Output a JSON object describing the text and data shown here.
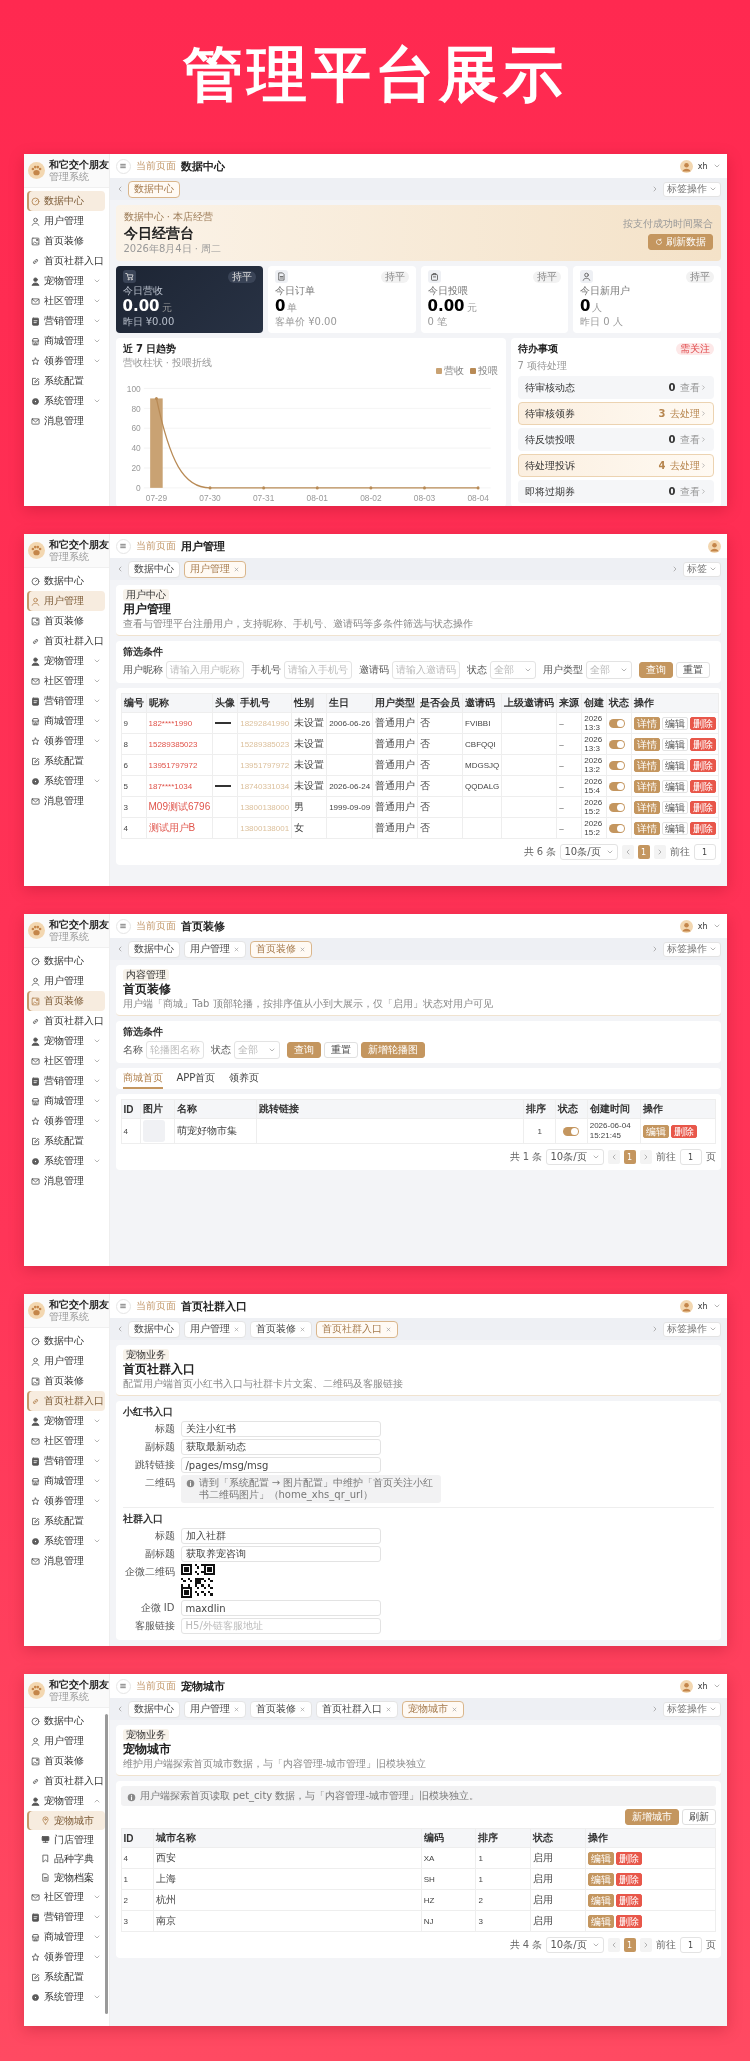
{
  "title": "管理平台展示",
  "screens": [
    {
      "sidebar": {
        "brand": "和它交个朋友",
        "subtitle": "管理系统",
        "items": [
          {
            "label": "数据中心",
            "kind": "link",
            "selected": true
          },
          {
            "label": "用户管理",
            "kind": "link",
            "selected": false
          },
          {
            "label": "首页装修",
            "kind": "link",
            "selected": false
          },
          {
            "label": "首页社群入口",
            "kind": "link",
            "selected": false
          },
          {
            "label": "宠物管理",
            "kind": "group",
            "expanded": false,
            "selected": false
          },
          {
            "label": "社区管理",
            "kind": "group",
            "expanded": false,
            "selected": false
          },
          {
            "label": "营销管理",
            "kind": "group",
            "expanded": false,
            "selected": false
          },
          {
            "label": "商城管理",
            "kind": "group",
            "expanded": false,
            "selected": false
          },
          {
            "label": "领券管理",
            "kind": "group",
            "expanded": false,
            "selected": false
          },
          {
            "label": "系统配置",
            "kind": "link",
            "selected": false
          },
          {
            "label": "系统管理",
            "kind": "group",
            "expanded": false,
            "selected": false
          },
          {
            "label": "消息管理",
            "kind": "link",
            "selected": false
          }
        ]
      },
      "header": {
        "crumb": "当前页面",
        "title": "数据中心",
        "user": "xh"
      },
      "tabs": [
        {
          "label": "数据中心",
          "selected": true,
          "closable": false
        }
      ],
      "tab_actions": "标签操作",
      "content": {
        "kind": "dashboard",
        "hero": {
          "crumb": "数据中心 · 本店经营",
          "title": "今日经营台",
          "date": "2026年8月4日 · 周二",
          "note": "按支付成功时间聚合",
          "button": "刷新数据"
        },
        "stats": [
          {
            "label": "今日营收",
            "value": "0.00",
            "unit": "元",
            "sub": "昨日 ¥0.00",
            "badge": "持平",
            "highlighted": true
          },
          {
            "label": "今日订单",
            "value": "0",
            "unit": "单",
            "sub": "客单价 ¥0.00",
            "badge": "持平",
            "highlighted": false
          },
          {
            "label": "今日投喂",
            "value": "0.00",
            "unit": "元",
            "sub": "0 笔",
            "badge": "持平",
            "highlighted": false
          },
          {
            "label": "今日新用户",
            "value": "0",
            "unit": "人",
            "sub": "昨日 0 人",
            "badge": "持平",
            "highlighted": false
          }
        ],
        "trend": {
          "title": "近 7 日趋势",
          "subtitle": "营收柱状 · 投喂折线",
          "chart_data": {
            "type": "bar",
            "categories": [
              "07-29",
              "07-30",
              "07-31",
              "08-01",
              "08-02",
              "08-03",
              "08-04"
            ],
            "series": [
              {
                "name": "营收",
                "color": "#c9a273",
                "values": [
                  90,
                  0,
                  0,
                  0,
                  0,
                  0,
                  0
                ]
              },
              {
                "name": "投喂",
                "type": "line",
                "color": "#b88a55",
                "values": [
                  90,
                  0,
                  0,
                  0,
                  0,
                  0,
                  0
                ]
              }
            ],
            "ylim": [
              0,
              100
            ],
            "yticks": [
              0,
              20,
              40,
              60,
              80,
              100
            ],
            "grid": true
          }
        },
        "todo": {
          "title": "待办事项",
          "subtitle": "7 项待处理",
          "badge": "需关注",
          "items": [
            {
              "label": "待审核动态",
              "count": "0",
              "action": "查看",
              "urgent": false
            },
            {
              "label": "待审核领券",
              "count": "3",
              "action": "去处理",
              "urgent": true
            },
            {
              "label": "待反馈投喂",
              "count": "0",
              "action": "查看",
              "urgent": false
            },
            {
              "label": "待处理投诉",
              "count": "4",
              "action": "去处理",
              "urgent": true
            },
            {
              "label": "即将过期券",
              "count": "0",
              "action": "查看",
              "urgent": false
            }
          ]
        }
      }
    },
    {
      "sidebar": {
        "brand": "和它交个朋友",
        "subtitle": "管理系统",
        "items": [
          {
            "label": "数据中心",
            "kind": "link",
            "selected": false
          },
          {
            "label": "用户管理",
            "kind": "link",
            "selected": true
          },
          {
            "label": "首页装修",
            "kind": "link",
            "selected": false
          },
          {
            "label": "首页社群入口",
            "kind": "link",
            "selected": false
          },
          {
            "label": "宠物管理",
            "kind": "group",
            "expanded": false,
            "selected": false
          },
          {
            "label": "社区管理",
            "kind": "group",
            "expanded": false,
            "selected": false
          },
          {
            "label": "营销管理",
            "kind": "group",
            "expanded": false,
            "selected": false
          },
          {
            "label": "商城管理",
            "kind": "group",
            "expanded": false,
            "selected": false
          },
          {
            "label": "领券管理",
            "kind": "group",
            "expanded": false,
            "selected": false
          },
          {
            "label": "系统配置",
            "kind": "link",
            "selected": false
          },
          {
            "label": "系统管理",
            "kind": "group",
            "expanded": false,
            "selected": false
          },
          {
            "label": "消息管理",
            "kind": "link",
            "selected": false
          }
        ]
      },
      "header": {
        "crumb": "当前页面",
        "title": "用户管理"
      },
      "tabs": [
        {
          "label": "数据中心",
          "selected": false,
          "closable": false
        },
        {
          "label": "用户管理",
          "selected": true,
          "closable": true
        }
      ],
      "tab_actions": "标签",
      "content": {
        "kind": "users",
        "head": {
          "tag": "用户中心",
          "title": "用户管理",
          "desc": "查看与管理平台注册用户，支持昵称、手机号、邀请码等多条件筛选与状态操作"
        },
        "filter": {
          "title": "筛选条件",
          "fields": [
            {
              "label": "用户昵称",
              "kind": "input",
              "placeholder": "请输入用户昵称"
            },
            {
              "label": "手机号",
              "kind": "input",
              "placeholder": "请输入手机号"
            },
            {
              "label": "邀请码",
              "kind": "input",
              "placeholder": "请输入邀请码"
            },
            {
              "label": "状态",
              "kind": "select",
              "placeholder": "全部"
            },
            {
              "label": "用户类型",
              "kind": "select",
              "placeholder": "全部"
            }
          ],
          "buttons": [
            {
              "label": "查询",
              "kind": "primary"
            },
            {
              "label": "重置",
              "kind": "plain"
            }
          ]
        },
        "table": {
          "columns": [
            "编号",
            "昵称",
            "头像",
            "手机号",
            "性别",
            "生日",
            "用户类型",
            "是否会员",
            "邀请码",
            "上级邀请码",
            "来源",
            "创建",
            "状态",
            "操作"
          ],
          "rows": [
            {
              "id": "9",
              "nickname": "182****1990",
              "avatar": true,
              "phone": "18292841990",
              "gender": "未设置",
              "birthday": "2006-06-26",
              "type": "普通用户",
              "member": "否",
              "invite": "FVIBBI",
              "source": "–",
              "created": "2026 13:3",
              "on": true,
              "actions": [
                {
                  "label": "详情",
                  "kind": "primary"
                },
                {
                  "label": "编辑",
                  "kind": "plain"
                },
                {
                  "label": "删除",
                  "kind": "danger"
                }
              ]
            },
            {
              "id": "8",
              "nickname": "15289385023",
              "avatar": false,
              "phone": "15289385023",
              "gender": "未设置",
              "type": "普通用户",
              "member": "否",
              "invite": "CBFQQI",
              "source": "–",
              "created": "2026 13:3",
              "on": true,
              "actions": [
                {
                  "label": "详情",
                  "kind": "primary"
                },
                {
                  "label": "编辑",
                  "kind": "plain"
                },
                {
                  "label": "删除",
                  "kind": "danger"
                }
              ]
            },
            {
              "id": "6",
              "nickname": "13951797972",
              "avatar": false,
              "phone": "13951797972",
              "gender": "未设置",
              "type": "普通用户",
              "member": "否",
              "invite": "MDGSJQ",
              "source": "–",
              "created": "2026 13:2",
              "on": true,
              "actions": [
                {
                  "label": "详情",
                  "kind": "primary"
                },
                {
                  "label": "编辑",
                  "kind": "plain"
                },
                {
                  "label": "删除",
                  "kind": "danger"
                }
              ]
            },
            {
              "id": "5",
              "nickname": "187****1034",
              "avatar": true,
              "phone": "18740331034",
              "gender": "未设置",
              "birthday": "2026-06-24",
              "type": "普通用户",
              "member": "否",
              "invite": "QQDALG",
              "source": "–",
              "created": "2026 15:4",
              "on": true,
              "actions": [
                {
                  "label": "详情",
                  "kind": "primary"
                },
                {
                  "label": "编辑",
                  "kind": "plain"
                },
                {
                  "label": "删除",
                  "kind": "danger"
                }
              ]
            },
            {
              "id": "3",
              "nickname": "M09测试6796",
              "avatar": false,
              "phone": "13800138000",
              "gender": "男",
              "birthday": "1999-09-09",
              "type": "普通用户",
              "member": "否",
              "source": "–",
              "created": "2026 15:2",
              "on": true,
              "actions": [
                {
                  "label": "详情",
                  "kind": "primary"
                },
                {
                  "label": "编辑",
                  "kind": "plain"
                },
                {
                  "label": "删除",
                  "kind": "danger"
                }
              ]
            },
            {
              "id": "4",
              "nickname": "测试用户B",
              "avatar": false,
              "phone": "13800138001",
              "gender": "女",
              "type": "普通用户",
              "member": "否",
              "source": "–",
              "created": "2026 15:2",
              "on": true,
              "actions": [
                {
                  "label": "详情",
                  "kind": "primary"
                },
                {
                  "label": "编辑",
                  "kind": "plain"
                },
                {
                  "label": "删除",
                  "kind": "danger"
                }
              ]
            }
          ]
        },
        "pagination": {
          "total": "共 6 条",
          "size": "10条/页",
          "page": "1",
          "goto": "前往",
          "goto_value": "1"
        }
      }
    },
    {
      "sidebar": {
        "brand": "和它交个朋友",
        "subtitle": "管理系统",
        "items": [
          {
            "label": "数据中心",
            "kind": "link",
            "selected": false
          },
          {
            "label": "用户管理",
            "kind": "link",
            "selected": false
          },
          {
            "label": "首页装修",
            "kind": "link",
            "selected": true
          },
          {
            "label": "首页社群入口",
            "kind": "link",
            "selected": false
          },
          {
            "label": "宠物管理",
            "kind": "group",
            "expanded": false,
            "selected": false
          },
          {
            "label": "社区管理",
            "kind": "group",
            "expanded": false,
            "selected": false
          },
          {
            "label": "营销管理",
            "kind": "group",
            "expanded": false,
            "selected": false
          },
          {
            "label": "商城管理",
            "kind": "group",
            "expanded": false,
            "selected": false
          },
          {
            "label": "领券管理",
            "kind": "group",
            "expanded": false,
            "selected": false
          },
          {
            "label": "系统配置",
            "kind": "link",
            "selected": false
          },
          {
            "label": "系统管理",
            "kind": "group",
            "expanded": false,
            "selected": false
          },
          {
            "label": "消息管理",
            "kind": "link",
            "selected": false
          }
        ]
      },
      "header": {
        "crumb": "当前页面",
        "title": "首页装修",
        "user": "xh"
      },
      "tabs": [
        {
          "label": "数据中心",
          "selected": false,
          "closable": false
        },
        {
          "label": "用户管理",
          "selected": false,
          "closable": true
        },
        {
          "label": "首页装修",
          "selected": true,
          "closable": true
        }
      ],
      "tab_actions": "标签操作",
      "content": {
        "kind": "banners",
        "head": {
          "tag": "内容管理",
          "title": "首页装修",
          "desc": "用户端「商城」Tab 顶部轮播，按排序值从小到大展示，仅「启用」状态对用户可见"
        },
        "filter": {
          "title": "筛选条件",
          "fields": [
            {
              "label": "名称",
              "kind": "input",
              "placeholder": "轮播图名称"
            },
            {
              "label": "状态",
              "kind": "select",
              "placeholder": "全部"
            }
          ],
          "buttons": [
            {
              "label": "查询",
              "kind": "primary"
            },
            {
              "label": "重置",
              "kind": "plain"
            },
            {
              "label": "新增轮播图",
              "kind": "primary"
            }
          ]
        },
        "subtabs": [
          {
            "label": "商城首页",
            "selected": true
          },
          {
            "label": "APP首页",
            "selected": false
          },
          {
            "label": "领养页",
            "selected": false
          }
        ],
        "table": {
          "columns": [
            "ID",
            "图片",
            "名称",
            "跳转链接",
            "排序",
            "状态",
            "创建时间",
            "操作"
          ],
          "rows": [
            {
              "id": "4",
              "name": "萌宠好物市集",
              "sort": "1",
              "on": true,
              "created": "2026-06-04 15:21:45",
              "actions": [
                {
                  "label": "编辑",
                  "kind": "primary"
                },
                {
                  "label": "删除",
                  "kind": "danger"
                }
              ]
            }
          ]
        },
        "pagination": {
          "total": "共 1 条",
          "size": "10条/页",
          "page": "1",
          "goto": "前往",
          "goto_value": "1",
          "unit": "页"
        }
      }
    },
    {
      "sidebar": {
        "brand": "和它交个朋友",
        "subtitle": "管理系统",
        "items": [
          {
            "label": "数据中心",
            "kind": "link",
            "selected": false
          },
          {
            "label": "用户管理",
            "kind": "link",
            "selected": false
          },
          {
            "label": "首页装修",
            "kind": "link",
            "selected": false
          },
          {
            "label": "首页社群入口",
            "kind": "link",
            "selected": true
          },
          {
            "label": "宠物管理",
            "kind": "group",
            "expanded": false,
            "selected": false
          },
          {
            "label": "社区管理",
            "kind": "group",
            "expanded": false,
            "selected": false
          },
          {
            "label": "营销管理",
            "kind": "group",
            "expanded": false,
            "selected": false
          },
          {
            "label": "商城管理",
            "kind": "group",
            "expanded": false,
            "selected": false
          },
          {
            "label": "领券管理",
            "kind": "group",
            "expanded": false,
            "selected": false
          },
          {
            "label": "系统配置",
            "kind": "link",
            "selected": false
          },
          {
            "label": "系统管理",
            "kind": "group",
            "expanded": false,
            "selected": false
          },
          {
            "label": "消息管理",
            "kind": "link",
            "selected": false
          }
        ]
      },
      "header": {
        "crumb": "当前页面",
        "title": "首页社群入口",
        "user": "xh"
      },
      "tabs": [
        {
          "label": "数据中心",
          "selected": false,
          "closable": false
        },
        {
          "label": "用户管理",
          "selected": false,
          "closable": true
        },
        {
          "label": "首页装修",
          "selected": false,
          "closable": true
        },
        {
          "label": "首页社群入口",
          "selected": true,
          "closable": true
        }
      ],
      "tab_actions": "标签操作",
      "content": {
        "kind": "community",
        "head": {
          "tag": "宠物业务",
          "title": "首页社群入口",
          "desc": "配置用户端首页小红书入口与社群卡片文案、二维码及客服链接"
        },
        "sections": [
          {
            "title": "小红书入口",
            "rows": [
              {
                "label": "标题",
                "kind": "input",
                "value": "关注小红书"
              },
              {
                "label": "副标题",
                "kind": "input",
                "value": "获取最新动态"
              },
              {
                "label": "跳转链接",
                "kind": "input",
                "value": "/pages/msg/msg"
              },
              {
                "label": "二维码",
                "kind": "notice",
                "text": "请到「系统配置 → 图片配置」中维护「首页关注小红书二维码图片」（home_xhs_qr_url）"
              }
            ]
          },
          {
            "title": "社群入口",
            "rows": [
              {
                "label": "标题",
                "kind": "input",
                "value": "加入社群"
              },
              {
                "label": "副标题",
                "kind": "input",
                "value": "获取养宠咨询"
              },
              {
                "label": "企微二维码",
                "kind": "qr"
              },
              {
                "label": "企微 ID",
                "kind": "input",
                "value": "maxdlin"
              },
              {
                "label": "客服链接",
                "kind": "input",
                "placeholder": "H5/外链客服地址"
              }
            ]
          }
        ]
      }
    },
    {
      "sidebar": {
        "brand": "和它交个朋友",
        "subtitle": "管理系统",
        "scrollbar": true,
        "items": [
          {
            "label": "数据中心",
            "kind": "link",
            "selected": false
          },
          {
            "label": "用户管理",
            "kind": "link",
            "selected": false
          },
          {
            "label": "首页装修",
            "kind": "link",
            "selected": false
          },
          {
            "label": "首页社群入口",
            "kind": "link",
            "selected": false
          },
          {
            "label": "宠物管理",
            "kind": "group",
            "expanded": true,
            "selected": false,
            "children": [
              {
                "label": "宠物城市",
                "selected": true
              },
              {
                "label": "门店管理",
                "selected": false
              },
              {
                "label": "品种字典",
                "selected": false
              },
              {
                "label": "宠物档案",
                "selected": false
              }
            ]
          },
          {
            "label": "社区管理",
            "kind": "group",
            "expanded": false,
            "selected": false
          },
          {
            "label": "营销管理",
            "kind": "group",
            "expanded": false,
            "selected": false
          },
          {
            "label": "商城管理",
            "kind": "group",
            "expanded": false,
            "selected": false
          },
          {
            "label": "领券管理",
            "kind": "group",
            "expanded": false,
            "selected": false
          },
          {
            "label": "系统配置",
            "kind": "link",
            "selected": false
          },
          {
            "label": "系统管理",
            "kind": "group",
            "expanded": false,
            "selected": false
          }
        ]
      },
      "header": {
        "crumb": "当前页面",
        "title": "宠物城市",
        "user": "xh"
      },
      "tabs": [
        {
          "label": "数据中心",
          "selected": false,
          "closable": false
        },
        {
          "label": "用户管理",
          "selected": false,
          "closable": true
        },
        {
          "label": "首页装修",
          "selected": false,
          "closable": true
        },
        {
          "label": "首页社群入口",
          "selected": false,
          "closable": true
        },
        {
          "label": "宠物城市",
          "selected": true,
          "closable": true
        }
      ],
      "tab_actions": "标签操作",
      "content": {
        "kind": "cities",
        "head": {
          "tag": "宠物业务",
          "title": "宠物城市",
          "desc": "维护用户端探索首页城市数据，与「内容管理-城市管理」旧模块独立"
        },
        "notice": "用户端探索首页读取 pet_city 数据，与「内容管理-城市管理」旧模块独立。",
        "buttons": [
          {
            "label": "新增城市",
            "kind": "primary"
          },
          {
            "label": "刷新",
            "kind": "plain"
          }
        ],
        "table": {
          "columns": [
            "ID",
            "城市名称",
            "编码",
            "排序",
            "状态",
            "操作"
          ],
          "rows": [
            {
              "id": "4",
              "name": "西安",
              "code": "XA",
              "sort": "1",
              "status": "启用",
              "actions": [
                {
                  "label": "编辑",
                  "kind": "primary"
                },
                {
                  "label": "删除",
                  "kind": "danger"
                }
              ]
            },
            {
              "id": "1",
              "name": "上海",
              "code": "SH",
              "sort": "1",
              "status": "启用",
              "actions": [
                {
                  "label": "编辑",
                  "kind": "primary"
                },
                {
                  "label": "删除",
                  "kind": "danger"
                }
              ]
            },
            {
              "id": "2",
              "name": "杭州",
              "code": "HZ",
              "sort": "2",
              "status": "启用",
              "actions": [
                {
                  "label": "编辑",
                  "kind": "primary"
                },
                {
                  "label": "删除",
                  "kind": "danger"
                }
              ]
            },
            {
              "id": "3",
              "name": "南京",
              "code": "NJ",
              "sort": "3",
              "status": "启用",
              "actions": [
                {
                  "label": "编辑",
                  "kind": "primary"
                },
                {
                  "label": "删除",
                  "kind": "danger"
                }
              ]
            }
          ]
        },
        "pagination": {
          "total": "共 4 条",
          "size": "10条/页",
          "page": "1",
          "goto": "前往",
          "goto_value": "1",
          "unit": "页"
        }
      }
    }
  ]
}
